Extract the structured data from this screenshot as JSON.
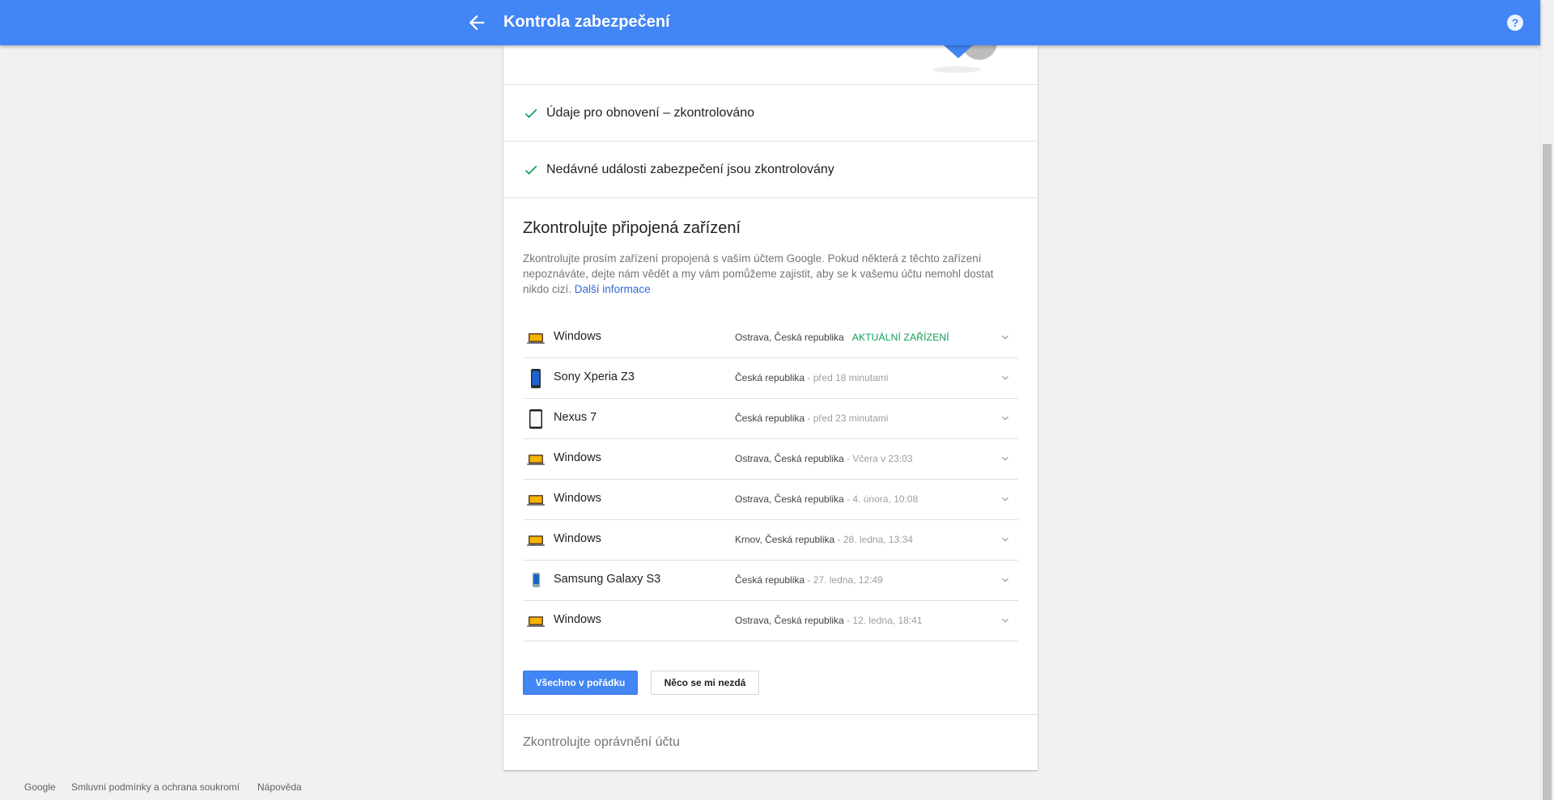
{
  "header": {
    "title": "Kontrola zabezpečení",
    "bg_color": "#4285f4"
  },
  "checks": [
    {
      "label": "Údaje pro obnovení – zkontrolováno",
      "icon": "check-icon"
    },
    {
      "label": "Nedávné události zabezpečení jsou zkontrolovány",
      "icon": "check-icon"
    }
  ],
  "devices_section": {
    "title": "Zkontrolujte připojená zařízení",
    "description": "Zkontrolujte prosím zařízení propojená s vaším účtem Google. Pokud některá z těchto zařízení nepoznáváte, dejte nám vědět a my vám pomůžeme zajistit, aby se k vašemu účtu nemohl dostat nikdo cizí.",
    "more_info_link": "Další informace",
    "devices": [
      {
        "name": "Windows",
        "icon": "laptop-icon",
        "location": "Ostrava, Česká republika",
        "sep": "",
        "time": "",
        "current": "AKTUÁLNÍ ZAŘÍZENÍ"
      },
      {
        "name": "Sony Xperia Z3",
        "icon": "phone-blue-icon",
        "location": "Česká republika",
        "sep": " - ",
        "time": "před 18 minutami",
        "current": ""
      },
      {
        "name": "Nexus 7",
        "icon": "tablet-icon",
        "location": "Česká republika",
        "sep": " - ",
        "time": "před 23 minutami",
        "current": ""
      },
      {
        "name": "Windows",
        "icon": "laptop-icon",
        "location": "Ostrava, Česká republika",
        "sep": " - ",
        "time": "Včera v 23:03",
        "current": ""
      },
      {
        "name": "Windows",
        "icon": "laptop-icon",
        "location": "Ostrava, Česká republika",
        "sep": " - ",
        "time": "4. února, 10:08",
        "current": ""
      },
      {
        "name": "Windows",
        "icon": "laptop-icon",
        "location": "Krnov, Česká republika",
        "sep": " - ",
        "time": "28. ledna, 13:34",
        "current": ""
      },
      {
        "name": "Samsung Galaxy S3",
        "icon": "phone-samsung-icon",
        "location": "Česká republika",
        "sep": " - ",
        "time": "27. ledna, 12:49",
        "current": ""
      },
      {
        "name": "Windows",
        "icon": "laptop-icon",
        "location": "Ostrava, Česká republika",
        "sep": " - ",
        "time": "12. ledna, 18:41",
        "current": ""
      }
    ],
    "ok_button": "Všechno v pořádku",
    "suspicious_button": "Něco se mi nezdá"
  },
  "permissions_link": "Zkontrolujte oprávnění účtu",
  "footer": {
    "links": [
      "Google",
      "Smluvní podmínky a ochrana soukromí",
      "Nápověda"
    ]
  },
  "colors": {
    "accent": "#4285f4",
    "check": "#0f9d58",
    "current_device": "#0f9d58",
    "link": "#3367d6"
  }
}
